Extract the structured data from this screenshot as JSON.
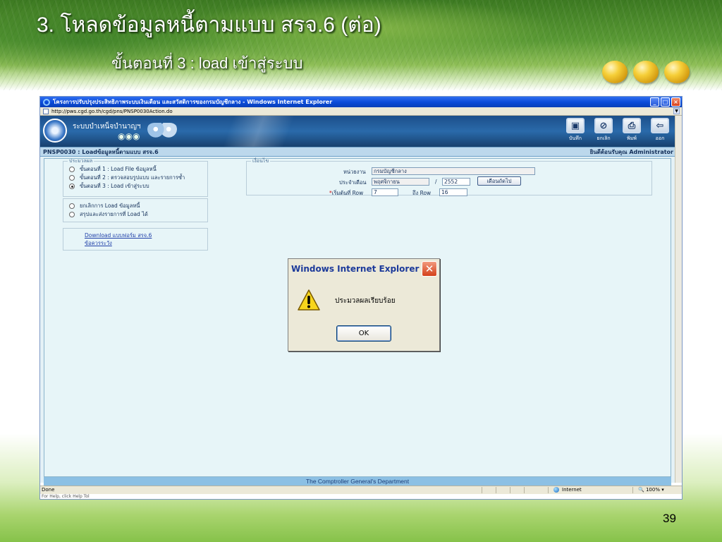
{
  "slide": {
    "title": "3. โหลดข้อมูลหนี้ตามแบบ สรจ.6 (ต่อ)",
    "subtitle": "ขั้นตอนที่ 3 : load เข้าสู่ระบบ",
    "page_number": "39"
  },
  "browser": {
    "window_title": "โครงการปรับปรุงประสิทธิภาพระบบเงินเดือน และสวัสดิการของกรมบัญชีกลาง - Windows Internet Explorer",
    "address": "http://pws.cgd.go.th/cgd/pns/PNSP0030Action.do",
    "status_text": "Done",
    "zone_text": "Internet",
    "zoom_text": "100%",
    "hint_text": "For Help, click Help Tol"
  },
  "app": {
    "system_name": "ระบบบำเหน็จบำนาญฯ",
    "toolbar": [
      {
        "label": "บันทึก",
        "icon": "save-icon"
      },
      {
        "label": "ยกเลิก",
        "icon": "cancel-icon"
      },
      {
        "label": "พิมพ์",
        "icon": "print-icon"
      },
      {
        "label": "ออก",
        "icon": "exit-icon"
      }
    ],
    "page_title": "PNSP0030 : Loadข้อมูลหนี้ตามแบบ สรจ.6",
    "welcome": "ยินดีต้อนรับคุณ Administrator",
    "process_legend": "ประมวลผล",
    "steps": [
      {
        "label": "ขั้นตอนที่ 1 : Load File ข้อมูลหนี้",
        "selected": false
      },
      {
        "label": "ขั้นตอนที่ 2 : ตรวจสอบรูปแบบ และรายการซ้ำ",
        "selected": false
      },
      {
        "label": "ขั้นตอนที่ 3 : Load เข้าสู่ระบบ",
        "selected": true
      }
    ],
    "options": [
      {
        "label": "ยกเลิกการ Load ข้อมูลหนี้"
      },
      {
        "label": "สรุปและส่งรายการที่ Load ได้"
      }
    ],
    "links": [
      "Download แบบฟอร์ม สรจ.6",
      "ข้อควรระวัง"
    ],
    "condition_legend": "เงื่อนไข",
    "agency_label": "หน่วยงาน",
    "agency_value": "กรมบัญชีกลาง",
    "month_label": "ประจำเดือน",
    "month_value": "พฤศจิกายน",
    "slash": "/",
    "year_value": "2552",
    "next_month_button": "เดือนถัดไป",
    "start_row_label": "เริ่มต้นที่ Row",
    "required_mark": "*",
    "start_row_value": "7",
    "end_row_label": "ถึง Row",
    "end_row_value": "16",
    "footer": "The Comptroller General's Department"
  },
  "dialog": {
    "title": "Windows Internet Explorer",
    "message": "ประมวลผลเรียบร้อย",
    "ok_label": "OK"
  },
  "colors": {
    "slide_green": "#5a9a35",
    "ie_title_blue": "#0a4ad8",
    "content_bg": "#e4f1f6",
    "bullet_gold": "#f6cf38"
  }
}
